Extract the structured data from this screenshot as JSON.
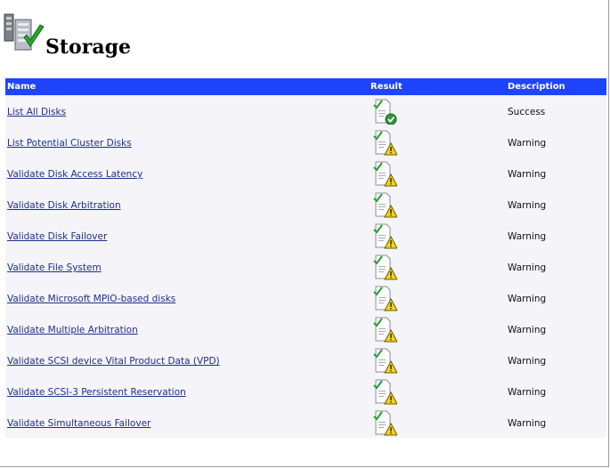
{
  "page": {
    "title": "Storage"
  },
  "table": {
    "headers": {
      "name": "Name",
      "result": "Result",
      "description": "Description"
    },
    "rows": [
      {
        "name": "List All Disks",
        "result_icon": "success-icon",
        "description": "Success"
      },
      {
        "name": "List Potential Cluster Disks",
        "result_icon": "warning-icon",
        "description": "Warning"
      },
      {
        "name": "Validate Disk Access Latency",
        "result_icon": "warning-icon",
        "description": "Warning"
      },
      {
        "name": "Validate Disk Arbitration",
        "result_icon": "warning-icon",
        "description": "Warning"
      },
      {
        "name": "Validate Disk Failover",
        "result_icon": "warning-icon",
        "description": "Warning"
      },
      {
        "name": "Validate File System",
        "result_icon": "warning-icon",
        "description": "Warning"
      },
      {
        "name": "Validate Microsoft MPIO-based disks",
        "result_icon": "warning-icon",
        "description": "Warning"
      },
      {
        "name": "Validate Multiple Arbitration",
        "result_icon": "warning-icon",
        "description": "Warning"
      },
      {
        "name": "Validate SCSI device Vital Product Data (VPD)",
        "result_icon": "warning-icon",
        "description": "Warning"
      },
      {
        "name": "Validate SCSI-3 Persistent Reservation",
        "result_icon": "warning-icon",
        "description": "Warning"
      },
      {
        "name": "Validate Simultaneous Failover",
        "result_icon": "warning-icon",
        "description": "Warning"
      }
    ]
  },
  "colors": {
    "header_bg": "#1f45fc",
    "link": "#1e2f8c",
    "row_bg": "#f5f4f8"
  }
}
